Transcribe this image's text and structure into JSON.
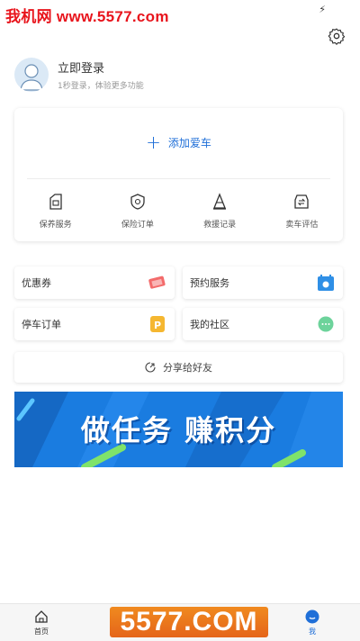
{
  "watermark": {
    "top": "我机网 www.5577.com",
    "bottom": "5577.COM"
  },
  "profile": {
    "title": "立即登录",
    "subtitle": "1秒登录，体验更多功能"
  },
  "add_car": {
    "label": "添加爱车"
  },
  "services": [
    {
      "label": "保养服务",
      "icon": "maintenance-icon"
    },
    {
      "label": "保险订单",
      "icon": "insurance-icon"
    },
    {
      "label": "救援记录",
      "icon": "rescue-icon"
    },
    {
      "label": "卖车评估",
      "icon": "sell-car-icon"
    }
  ],
  "tiles": [
    {
      "label": "优惠券",
      "icon": "coupon-icon"
    },
    {
      "label": "预约服务",
      "icon": "appointment-icon"
    },
    {
      "label": "停车订单",
      "icon": "parking-icon"
    },
    {
      "label": "我的社区",
      "icon": "community-icon"
    }
  ],
  "share": {
    "label": "分享给好友"
  },
  "banner": {
    "text": "做任务 赚积分"
  },
  "tabbar": {
    "home": "首页",
    "me": "我"
  },
  "colors": {
    "accent": "#1f6fd8",
    "banner": "#1a7ce0",
    "watermark": "#e8141c"
  }
}
